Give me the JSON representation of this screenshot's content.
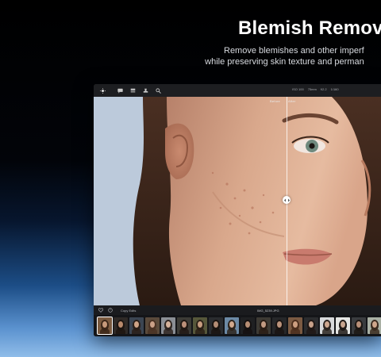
{
  "promo": {
    "headline": "Blemish Remov",
    "subline_1": "Remove blemishes and other imperf",
    "subline_2": "while preserving skin texture and perman"
  },
  "toolbar": {
    "icons": [
      "sun-icon",
      "chat-icon",
      "layers-icon",
      "stamp-icon",
      "zoom-icon"
    ],
    "camera_meta": [
      "ISO 100",
      "75mm",
      "f/2.2",
      "1/160"
    ]
  },
  "viewer": {
    "before_label": "Before",
    "after_label": "After",
    "split_position": 0.67
  },
  "bottombar": {
    "copy_edits_label": "Copy Edits",
    "filename": "IMG_5239.JPG"
  },
  "filmstrip": {
    "selected_index": 0,
    "thumbnails": [
      {
        "bg": "#7a5a3f",
        "skin": "#c79a7b",
        "hair": "#3a2618"
      },
      {
        "bg": "#2f2a27",
        "skin": "#b98a6c",
        "hair": "#1d1511"
      },
      {
        "bg": "#3b4552",
        "skin": "#cfa487",
        "hair": "#2a1f18"
      },
      {
        "bg": "#5a4a3b",
        "skin": "#caa088",
        "hair": "#4a3224"
      },
      {
        "bg": "#8b8f95",
        "skin": "#d5b29b",
        "hair": "#2f2621"
      },
      {
        "bg": "#3c3b36",
        "skin": "#bd917a",
        "hair": "#211914"
      },
      {
        "bg": "#56573a",
        "skin": "#c79d80",
        "hair": "#2b2016"
      },
      {
        "bg": "#2a2c2f",
        "skin": "#b48d75",
        "hair": "#1a1410"
      },
      {
        "bg": "#6c8aa6",
        "skin": "#d1a98e",
        "hair": "#2e241c"
      },
      {
        "bg": "#1f2022",
        "skin": "#b78e74",
        "hair": "#151110"
      },
      {
        "bg": "#3d3a34",
        "skin": "#c39b82",
        "hair": "#2a1d15"
      },
      {
        "bg": "#262729",
        "skin": "#bb937b",
        "hair": "#1a1412"
      },
      {
        "bg": "#7b5a42",
        "skin": "#cd9f80",
        "hair": "#4b2e1c"
      },
      {
        "bg": "#2b2c2e",
        "skin": "#c7a18a",
        "hair": "#201815"
      },
      {
        "bg": "#d8d9db",
        "skin": "#cfa890",
        "hair": "#2c2420"
      },
      {
        "bg": "#e6e6e4",
        "skin": "#c9a58f",
        "hair": "#1f1916"
      },
      {
        "bg": "#3a3c3f",
        "skin": "#b88f78",
        "hair": "#1c1613"
      },
      {
        "bg": "#a9b0a4",
        "skin": "#cfa68b",
        "hair": "#3a2a1f"
      },
      {
        "bg": "#596e4a",
        "skin": "#c89d82",
        "hair": "#2a1f16"
      },
      {
        "bg": "#c9cbc6",
        "skin": "#caa38b",
        "hair": "#231c18"
      },
      {
        "bg": "#2f3b2a",
        "skin": "#be957b",
        "hair": "#1d1511"
      }
    ]
  },
  "colors": {
    "accent": "#ffffff",
    "window_bg": "#1b1c1f"
  }
}
